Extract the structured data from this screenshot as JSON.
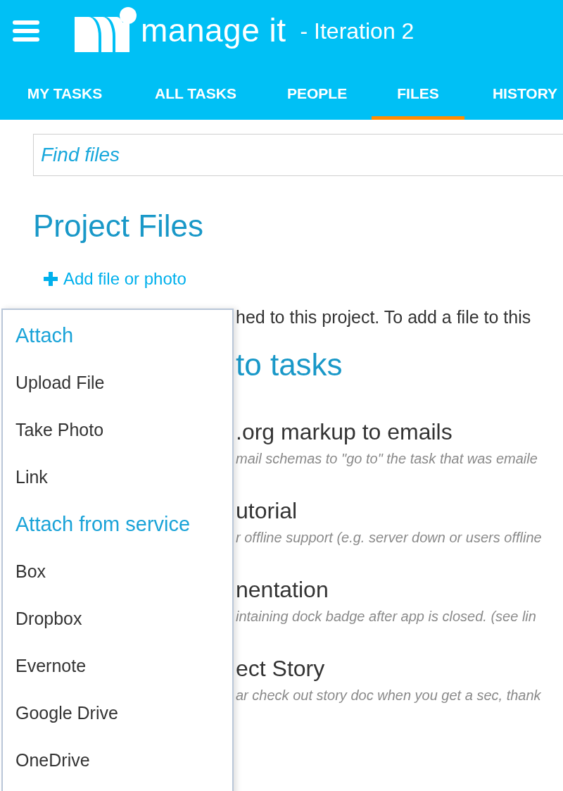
{
  "header": {
    "brand": "manage it",
    "subtitle": "- Iteration 2"
  },
  "tabs": [
    {
      "label": "MY TASKS",
      "selected": false
    },
    {
      "label": "ALL TASKS",
      "selected": false
    },
    {
      "label": "PEOPLE",
      "selected": false
    },
    {
      "label": "FILES",
      "selected": true
    },
    {
      "label": "HISTORY",
      "selected": false
    }
  ],
  "search": {
    "placeholder": "Find files"
  },
  "page_title": "Project Files",
  "add_link": "Add file or photo",
  "intro": "hed to this project. To add a file to this",
  "section_heading": "to tasks",
  "tasks": [
    {
      "title": ".org markup to emails",
      "description": "mail schemas to \"go to\" the task that was emaile"
    },
    {
      "title": "utorial",
      "description": "r offline support (e.g. server down or users offline"
    },
    {
      "title": "nentation",
      "description": "intaining dock badge after app is closed. (see lin"
    },
    {
      "title": "ect Story",
      "description": "ar check out story doc when you get a sec, thank"
    }
  ],
  "attach_menu": {
    "sections": [
      {
        "title": "Attach",
        "items": [
          "Upload File",
          "Take Photo",
          "Link"
        ]
      },
      {
        "title": "Attach from service",
        "items": [
          "Box",
          "Dropbox",
          "Evernote",
          "Google Drive",
          "OneDrive"
        ]
      }
    ]
  }
}
